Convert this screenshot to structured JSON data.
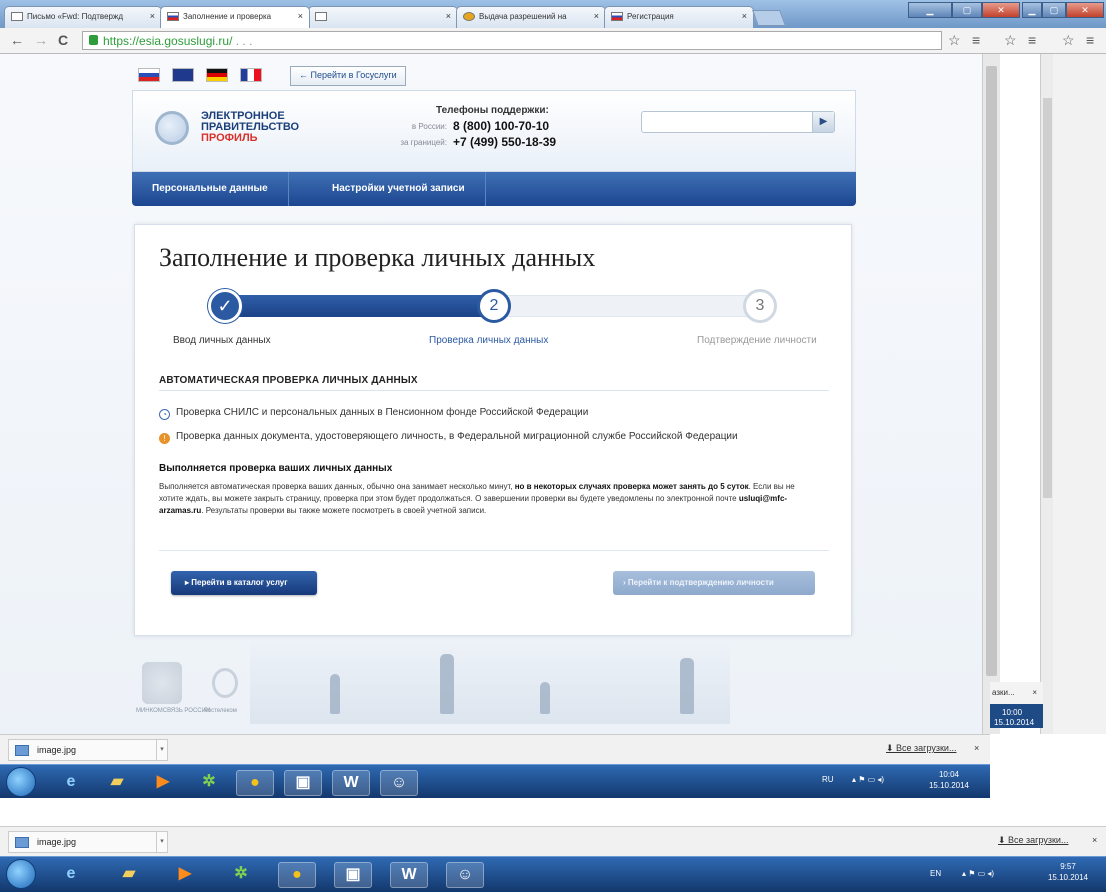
{
  "browser": {
    "tabs": [
      {
        "label": "Письмо «Fwd: Подтвержд",
        "close": "×"
      },
      {
        "label": "Заполнение и проверка",
        "close": "×"
      },
      {
        "label": "",
        "close": "×"
      },
      {
        "label": "Выдача разрешений на",
        "close": "×"
      },
      {
        "label": "Регистрация",
        "close": "×"
      }
    ],
    "url_secure": "https://esia.gosuslugi.ru/",
    "url_rest": "   .   .   .",
    "back_icon": "←",
    "forward_icon": "→",
    "reload_icon": "C",
    "star_icon": "☆",
    "menu_icon": "≡"
  },
  "site": {
    "languages": [
      "ru",
      "gb",
      "de",
      "fr"
    ],
    "gosuslugi_link": "← Перейти в Госуслуги",
    "logo": {
      "line1": "ЭЛЕКТРОННОЕ",
      "line2": "ПРАВИТЕЛЬСТВО",
      "line3": "ПРОФИЛЬ"
    },
    "phones": {
      "title": "Телефоны поддержки:",
      "russia_label": "в России:",
      "russia_number": "8 (800) 100-70-10",
      "abroad_label": "за границей:",
      "abroad_number": "+7 (499) 550-18-39"
    },
    "search_placeholder": "",
    "search_button": "▶",
    "nav": [
      "Персональные данные",
      "Настройки учетной записи"
    ]
  },
  "main": {
    "title": "Заполнение и проверка личных данных",
    "progress_fraction": 0.5,
    "steps": [
      {
        "mark": "✓",
        "label": "Ввод личных данных",
        "state": "done"
      },
      {
        "mark": "2",
        "label": "Проверка личных данных",
        "state": "current"
      },
      {
        "mark": "3",
        "label": "Подтверждение личности",
        "state": "next"
      }
    ],
    "section_title": "АВТОМАТИЧЕСКАЯ ПРОВЕРКА ЛИЧНЫХ ДАННЫХ",
    "checks": [
      {
        "icon": "clock-icon",
        "text": "Проверка СНИЛС и персональных данных в Пенсионном фонде Российской Федерации"
      },
      {
        "icon": "warning-icon",
        "text": "Проверка данных документа, удостоверяющего личность, в Федеральной миграционной службе Российской Федерации"
      }
    ],
    "running_title": "Выполняется проверка ваших личных данных",
    "running_text_1": "Выполняется автоматическая проверка ваших данных, обычно она занимает несколько минут, ",
    "running_bold_1": "но в некоторых случаях проверка может занять до 5 суток",
    "running_text_2": ". Если вы не хотите ждать, вы можете закрыть страницу, проверка при этом будет продолжаться. О завершении проверки вы будете уведомлены по электронной почте ",
    "running_email": "usluqi@mfc-arzamas.ru",
    "running_text_3": ". Результаты проверки вы также можете посмотреть в своей учетной записи.",
    "btn_catalog": "▸  Перейти в каталог услуг",
    "btn_confirm": "›  Перейти к подтверждению личности"
  },
  "footer": {
    "ministry": "МИНКОМСВЯЗЬ РОССИИ",
    "rostelecom": "Ростелеком"
  },
  "popup": {
    "title": "азки...",
    "close": "×",
    "time": "10:00",
    "date": "15.10.2014"
  },
  "downloads1": {
    "file": "image.jpg",
    "all": "⬇ Все загрузки...",
    "close": "×"
  },
  "downloads2": {
    "file": "image.jpg",
    "all": "⬇ Все загрузки...",
    "close": "×"
  },
  "taskbar1": {
    "lang": "RU",
    "time": "10:04",
    "date": "15.10.2014"
  },
  "taskbar2": {
    "lang": "EN",
    "time": "9:57",
    "date": "15.10.2014"
  }
}
